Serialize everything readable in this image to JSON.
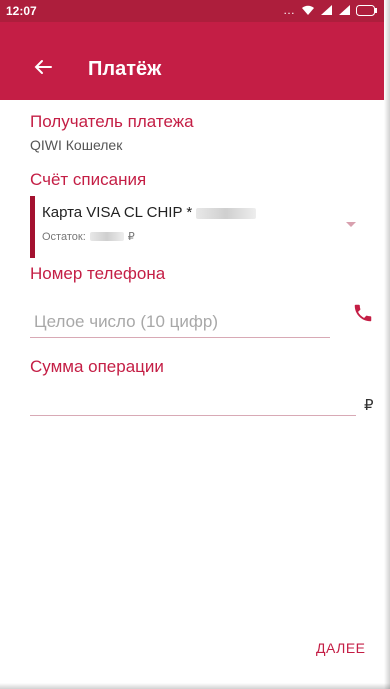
{
  "status_bar": {
    "time": "12:07",
    "icons": [
      "more-icon",
      "wifi-icon",
      "signal-icon",
      "signal-icon",
      "battery-icon"
    ]
  },
  "app_bar": {
    "title": "Платёж",
    "back_icon": "arrow-back-icon"
  },
  "recipient": {
    "label": "Получатель платежа",
    "value": "QIWI Кошелек"
  },
  "debit_account": {
    "label": "Счёт списания",
    "card_name": "Карта VISA CL CHIP *",
    "balance_label": "Остаток:",
    "balance_currency": "₽"
  },
  "phone": {
    "label": "Номер телефона",
    "placeholder": "Целое число (10 цифр)",
    "icon": "phone-icon"
  },
  "amount": {
    "label": "Сумма операции",
    "currency": "₽"
  },
  "actions": {
    "next_label": "ДАЛЕЕ"
  },
  "colors": {
    "accent": "#c41e45",
    "status_bar": "#ad1e3c",
    "card_marker": "#a3112f"
  }
}
